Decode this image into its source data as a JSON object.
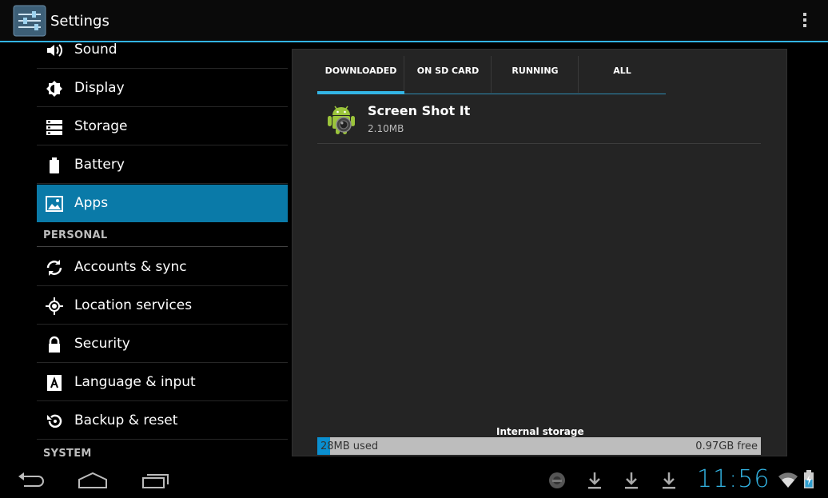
{
  "action_bar": {
    "title": "Settings",
    "icon": "settings-icon",
    "overflow_icon": "overflow-menu-icon"
  },
  "sidebar": {
    "items": [
      {
        "label": "Sound",
        "icon": "sound-icon"
      },
      {
        "label": "Display",
        "icon": "display-icon"
      },
      {
        "label": "Storage",
        "icon": "storage-icon"
      },
      {
        "label": "Battery",
        "icon": "battery-icon"
      },
      {
        "label": "Apps",
        "icon": "apps-icon",
        "active": true
      },
      {
        "label": "Accounts & sync",
        "icon": "sync-icon"
      },
      {
        "label": "Location services",
        "icon": "location-icon"
      },
      {
        "label": "Security",
        "icon": "lock-icon"
      },
      {
        "label": "Language & input",
        "icon": "language-icon"
      },
      {
        "label": "Backup & reset",
        "icon": "backup-icon"
      }
    ],
    "headers": {
      "personal": "PERSONAL",
      "system": "SYSTEM"
    }
  },
  "apps": {
    "tabs": [
      {
        "label": "DOWNLOADED",
        "active": true
      },
      {
        "label": "ON SD CARD"
      },
      {
        "label": "RUNNING"
      },
      {
        "label": "ALL"
      }
    ],
    "list": [
      {
        "name": "Screen Shot It",
        "size": "2.10MB",
        "icon": "android-icon"
      }
    ],
    "storage": {
      "label": "Internal storage",
      "used": "28MB used",
      "free": "0.97GB free",
      "used_fraction": 0.028,
      "accent": "#33b5e5"
    }
  },
  "system_bar": {
    "clock": "11:56",
    "nav_icons": [
      "back-icon",
      "home-icon",
      "recent-apps-icon"
    ],
    "notification_icons": [
      "screenshot-notif-icon",
      "download-icon",
      "download-icon",
      "download-icon"
    ],
    "status_icons": [
      "wifi-icon",
      "battery-charging-icon"
    ]
  }
}
